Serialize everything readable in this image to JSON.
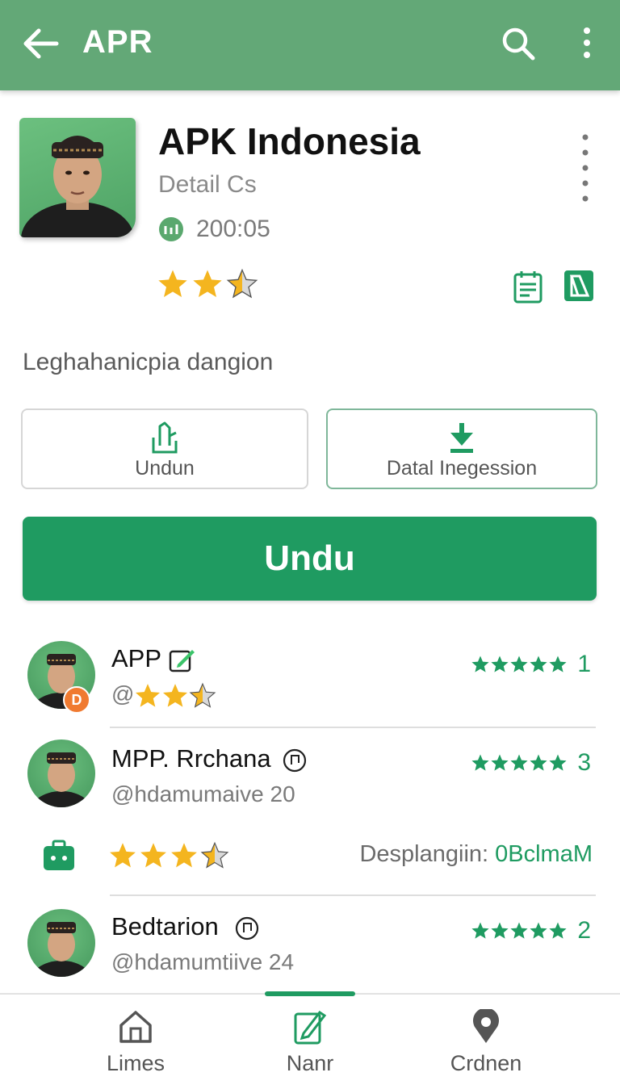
{
  "appbar": {
    "title": "APR"
  },
  "app": {
    "name": "APK Indonesia",
    "subtitle": "Detail Cs",
    "meta_value": "200:05",
    "rating_stars": 2.5,
    "description": "Leghahanicpia dangion"
  },
  "buttons": {
    "undun": "Undun",
    "datal": "Datal Inegession",
    "primary": "Undu"
  },
  "reviews": [
    {
      "name": "APP",
      "handle": "@",
      "handle_stars": 2.5,
      "rating_stars": 5,
      "count": "1",
      "badge": "D"
    },
    {
      "name": "MPP. Rrchana",
      "handle": "@hdamumaive 20",
      "rating_stars": 5,
      "count": "3"
    },
    {
      "name": "Bedtarion",
      "handle": "@hdamumtiive 24",
      "rating_stars": 5,
      "count": "2"
    }
  ],
  "downloads": {
    "stars": 3.5,
    "label": "Desplangiin: ",
    "value": "0BclmaM"
  },
  "nav": [
    {
      "label": "Limes",
      "icon": "home-icon"
    },
    {
      "label": "Nanr",
      "icon": "edit-document-icon",
      "active": true
    },
    {
      "label": "Crdnen",
      "icon": "location-pin-icon"
    }
  ],
  "colors": {
    "appbar": "#63a877",
    "accent": "#1f9b61",
    "star": "#f4b51f"
  }
}
